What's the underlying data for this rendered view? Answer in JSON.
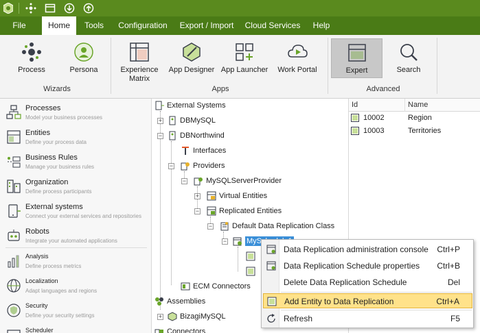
{
  "menu": {
    "tabs": [
      {
        "label": "File"
      },
      {
        "label": "Home"
      },
      {
        "label": "Tools"
      },
      {
        "label": "Configuration"
      },
      {
        "label": "Export / Import"
      },
      {
        "label": "Cloud Services"
      },
      {
        "label": "Help"
      }
    ],
    "active_tab": "Home"
  },
  "ribbon": {
    "process": "Process",
    "persona": "Persona",
    "group_wizards": "Wizards",
    "experience_matrix_1": "Experience",
    "experience_matrix_2": "Matrix",
    "app_designer": "App Designer",
    "app_launcher": "App Launcher",
    "work_portal": "Work Portal",
    "group_apps": "Apps",
    "expert": "Expert",
    "search": "Search",
    "group_advanced": "Advanced"
  },
  "leftnav": {
    "items": [
      {
        "title": "Processes",
        "subtitle": "Model your business processes"
      },
      {
        "title": "Entities",
        "subtitle": "Define your process data"
      },
      {
        "title": "Business Rules",
        "subtitle": "Manage your business rules"
      },
      {
        "title": "Organization",
        "subtitle": "Define process participants"
      },
      {
        "title": "External systems",
        "subtitle": "Connect your external services and repositories"
      },
      {
        "title": "Robots",
        "subtitle": "Integrate your automated applications"
      },
      {
        "title": "Analysis",
        "subtitle": "Define process metrics"
      },
      {
        "title": "Localization",
        "subtitle": "Adapt languages and regions"
      },
      {
        "title": "Security",
        "subtitle": "Define your security settings"
      },
      {
        "title": "Scheduler",
        "subtitle": ""
      }
    ]
  },
  "tree": {
    "external_systems": "External Systems",
    "dbmysql": "DBMySQL",
    "dbnorthwind": "DBNorthwind",
    "interfaces": "Interfaces",
    "providers": "Providers",
    "mysqlserverprovider": "MySQLServerProvider",
    "virtual_entities": "Virtual Entities",
    "replicated_entities": "Replicated Entities",
    "default_class": "Default Data Replication Class",
    "selected_node": "MySchedule1",
    "ecm_connectors": "ECM Connectors",
    "assemblies": "Assemblies",
    "bizagimysql": "BizagiMySQL",
    "connectors": "Connectors"
  },
  "grid": {
    "headers": [
      "Id",
      "Name"
    ],
    "rows": [
      {
        "id": "10002",
        "name": "Region"
      },
      {
        "id": "10003",
        "name": "Territories"
      }
    ]
  },
  "context_menu": {
    "items": [
      {
        "label": "Data Replication administration console",
        "shortcut": "Ctrl+P"
      },
      {
        "label": "Data Replication Schedule properties",
        "shortcut": "Ctrl+B"
      },
      {
        "label": "Delete Data Replication Schedule",
        "shortcut": "Del"
      },
      {
        "label": "Add Entity to Data Replication",
        "shortcut": "Ctrl+A"
      },
      {
        "label": "Refresh",
        "shortcut": "F5"
      }
    ],
    "highlighted_index": 3
  },
  "colors": {
    "titlebar": "#5a8a1e",
    "menubar": "#4a7b16",
    "selection": "#3a8fd8",
    "menu_highlight": "#ffe28a"
  }
}
